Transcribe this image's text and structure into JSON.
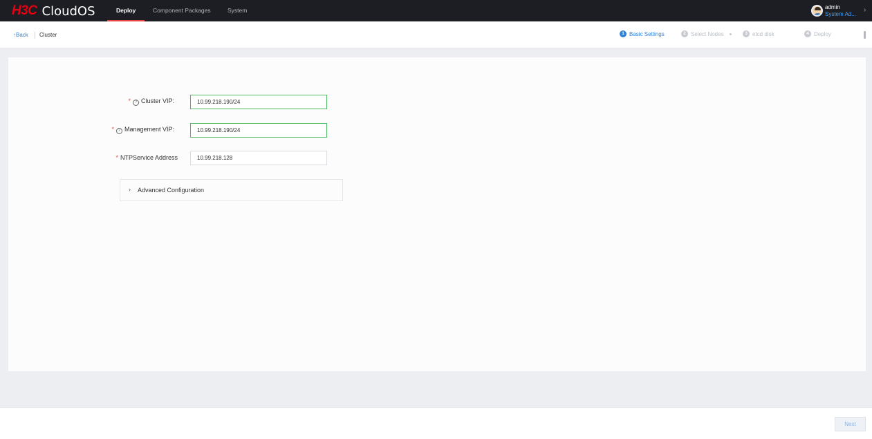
{
  "app": {
    "logo_mark": "H3C",
    "logo_text": "CloudOS"
  },
  "nav": {
    "tabs": [
      {
        "label": "Deploy",
        "active": true
      },
      {
        "label": "Component Packages",
        "active": false
      },
      {
        "label": "System",
        "active": false
      }
    ]
  },
  "user": {
    "name": "admin",
    "role": "System Ad..."
  },
  "subheader": {
    "back_label": "Back",
    "crumb": "Cluster",
    "steps": [
      {
        "num": "1",
        "label": "Basic Settings",
        "active": true
      },
      {
        "num": "2",
        "label": "Select Nodes",
        "active": false
      },
      {
        "num": "3",
        "label": "etcd disk",
        "active": false
      },
      {
        "num": "4",
        "label": "Deploy",
        "active": false
      }
    ]
  },
  "form": {
    "cluster_vip": {
      "label": "Cluster VIP:",
      "value": "10.99.218.190/24"
    },
    "management_vip": {
      "label": "Management VIP:",
      "value": "10.99.218.190/24"
    },
    "ntp": {
      "label": "NTPService Address",
      "value": "10.99.218.128"
    },
    "advanced_label": "Advanced Configuration"
  },
  "footer": {
    "next_label": "Next"
  },
  "colors": {
    "topbar": "#1c1e23",
    "accent_red": "#e8473f",
    "primary_blue": "#2e82d6",
    "valid_green": "#4cb860"
  }
}
